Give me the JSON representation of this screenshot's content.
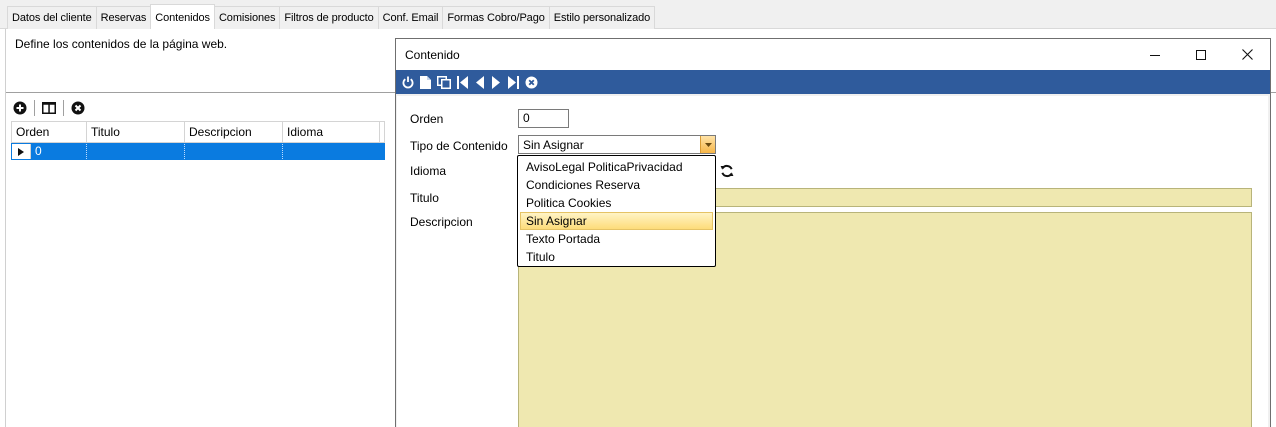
{
  "tabs": [
    {
      "label": "Datos del cliente",
      "active": false
    },
    {
      "label": "Reservas",
      "active": false
    },
    {
      "label": "Contenidos",
      "active": true
    },
    {
      "label": "Comisiones",
      "active": false
    },
    {
      "label": "Filtros de producto",
      "active": false
    },
    {
      "label": "Conf. Email",
      "active": false
    },
    {
      "label": "Formas Cobro/Pago",
      "active": false
    },
    {
      "label": "Estilo personalizado",
      "active": false
    }
  ],
  "page": {
    "description": "Define los contenidos de la página web."
  },
  "grid": {
    "toolbar_icons": [
      "add-icon",
      "columns-icon",
      "delete-icon"
    ],
    "columns": [
      "Orden",
      "Titulo",
      "Descripcion",
      "Idioma"
    ],
    "rows": [
      {
        "orden": "0",
        "titulo": "",
        "descripcion": "",
        "idioma": ""
      }
    ],
    "selection_color": "#0a7be0"
  },
  "dialog": {
    "title": "Contenido",
    "toolbar_icons": [
      "power-icon",
      "new-document-icon",
      "copy-icon",
      "first-record-icon",
      "previous-record-icon",
      "next-record-icon",
      "last-record-icon",
      "cancel-icon"
    ],
    "toolbar_color": "#2f5b9c",
    "fields": {
      "orden_label": "Orden",
      "orden_value": "0",
      "tipo_label": "Tipo de Contenido",
      "tipo_value": "Sin Asignar",
      "idioma_label": "Idioma",
      "titulo_label": "Titulo",
      "descripcion_label": "Descripcion"
    },
    "dropdown_options": [
      {
        "label": "AvisoLegal PoliticaPrivacidad",
        "selected": false
      },
      {
        "label": "Condiciones Reserva",
        "selected": false
      },
      {
        "label": "Politica Cookies",
        "selected": false
      },
      {
        "label": "Sin Asignar",
        "selected": true
      },
      {
        "label": "Texto Portada",
        "selected": false
      },
      {
        "label": "Titulo",
        "selected": false
      }
    ],
    "field_fill_color": "#efe8b0"
  }
}
